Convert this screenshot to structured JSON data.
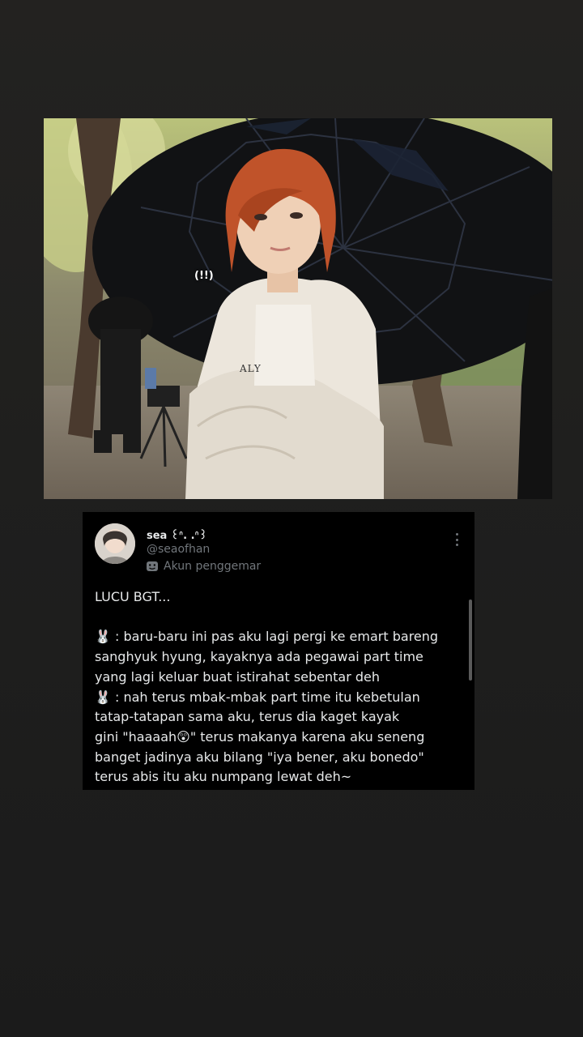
{
  "photo": {
    "caption": "(!!)",
    "shirt_logo": "ALY"
  },
  "tweet": {
    "author_name": "sea ꒰ᐢ. .ᐢ꒱",
    "author_handle": "@seaofhan",
    "fan_badge_icon": "theater-masks-icon",
    "fan_badge_label": "Akun penggemar",
    "more_icon": "more-vertical-icon",
    "lines": [
      "LUCU BGT...",
      "",
      "🐰 : baru-baru ini pas aku lagi pergi ke emart bareng",
      "sanghyuk hyung, kayaknya ada pegawai part time",
      "yang lagi keluar buat istirahat sebentar deh",
      "🐰 : nah terus mbak-mbak part time itu kebetulan",
      "tatap-tatapan sama aku, terus dia kaget kayak",
      "gini \"haaaah😲\" terus makanya karena aku seneng",
      "banget jadinya aku bilang \"iya bener, aku bonedo\"",
      "terus abis itu aku numpang lewat deh~"
    ]
  },
  "colors": {
    "background": "#1f1f1e",
    "tweet_bg": "#000000",
    "text_primary": "#e7e9ea",
    "text_secondary": "#71767b",
    "hair": "#c0532a"
  }
}
